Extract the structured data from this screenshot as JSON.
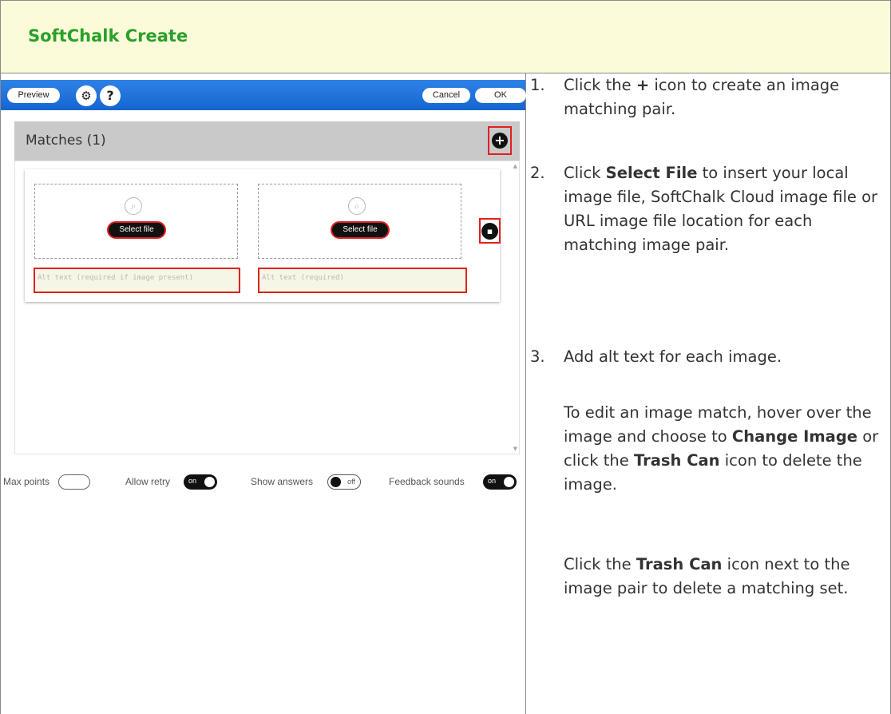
{
  "header": {
    "title": "SoftChalk Create"
  },
  "editor": {
    "topbar": {
      "preview_label": "Preview",
      "gear_icon": "⚙",
      "help_label": "?",
      "cancel_label": "Cancel",
      "ok_label": "OK"
    },
    "matches": {
      "title": "Matches (1)",
      "add_icon": "+"
    },
    "pair": {
      "select_file_1": "Select file",
      "select_file_2": "Select file",
      "alt_placeholder_1": "Alt text (required if image present)",
      "alt_placeholder_2": "Alt text (required)",
      "trash_icon": "🗑"
    },
    "options": {
      "max_points_label": "Max points",
      "allow_retry_label": "Allow retry",
      "allow_retry_state": "on",
      "show_answers_label": "Show answers",
      "show_answers_state": "off",
      "feedback_sounds_label": "Feedback sounds",
      "feedback_sounds_state": "on"
    }
  },
  "instructions": {
    "step1_num": "1.",
    "step1_pre": "Click the ",
    "step1_bold": "+",
    "step1_post": " icon to create an image matching pair.",
    "step2_num": "2.",
    "step2_pre": "Click ",
    "step2_bold": "Select File",
    "step2_post": " to insert your local image file, SoftChalk Cloud image file or URL image file location for each matching image pair.",
    "step3_num": "3.",
    "step3_text": "Add alt text for each image.",
    "para1_pre": "To edit an image match, hover over the image and choose to ",
    "para1_bold1": "Change Image",
    "para1_mid": " or click the ",
    "para1_bold2": "Trash Can",
    "para1_post": " icon to delete the image.",
    "para2_pre": "Click the ",
    "para2_bold": "Trash Can",
    "para2_post": " icon next to the image pair to delete a matching set."
  }
}
